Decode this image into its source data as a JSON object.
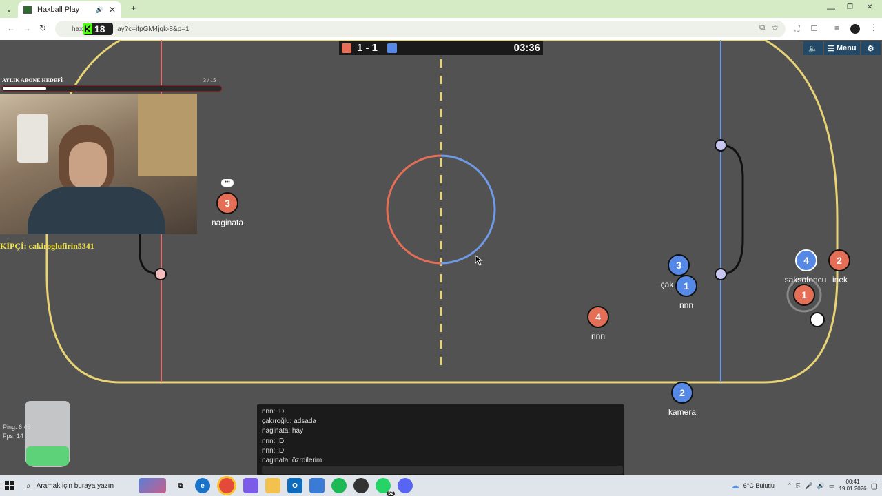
{
  "browser": {
    "tab_title": "Haxball Play",
    "url": "ay?c=ifpGM4jqk-8&p=1",
    "url_prefix": "hax",
    "window_controls": [
      "—",
      "❐",
      "✕"
    ]
  },
  "kick_badge": {
    "count": "18"
  },
  "game": {
    "score": "1 - 1",
    "time": "03:36",
    "menu_label": "Menu",
    "players": [
      {
        "team": "red",
        "number": "3",
        "name": "naginata"
      },
      {
        "team": "blue",
        "number": "3",
        "name": "çak"
      },
      {
        "team": "blue",
        "number": "1",
        "name": "nnn"
      },
      {
        "team": "blue",
        "number": "4",
        "name": "saksofoncu"
      },
      {
        "team": "red",
        "number": "2",
        "name": "inek"
      },
      {
        "team": "red",
        "number": "1",
        "name": ""
      },
      {
        "team": "red",
        "number": "4",
        "name": "nnn"
      },
      {
        "team": "blue",
        "number": "2",
        "name": "kamera"
      }
    ],
    "stats": {
      "ping": "Ping: 6",
      "ping2": "48",
      "fps": "Fps: 14"
    }
  },
  "overlay": {
    "goal_label": "AYLIK ABONE HEDEFİ",
    "goal_count": "3",
    "goal_total": "/ 15",
    "goal_progress": 0.2,
    "sponsor": "KİPÇİ: cakiroglufirin5341"
  },
  "chat": {
    "messages": [
      "nnn: :D",
      "çakıroğlu: adsada",
      "naginata: hay",
      "nnn: :D",
      "nnn: :D",
      "naginata: özrdilerim"
    ]
  },
  "taskbar": {
    "search_placeholder": "Aramak için buraya yazın",
    "weather": "6°C  Bulutlu",
    "time": "00:41",
    "date": "19.01.2026",
    "whatsapp_badge": "52"
  },
  "colors": {
    "red_team": "#e56e56",
    "blue_team": "#5689e5",
    "field_border": "#e8d474"
  }
}
